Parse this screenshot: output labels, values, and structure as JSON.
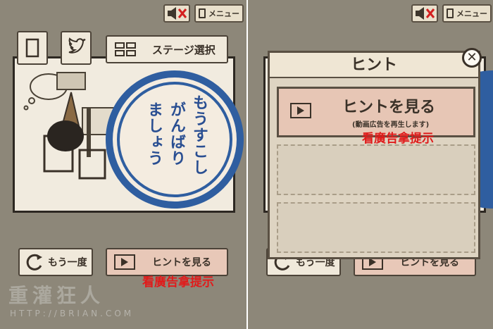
{
  "left": {
    "topbar": {
      "menu_label": "メニュー"
    },
    "stage_select_label": "ステージ選択",
    "encouragement": [
      "もうすこし",
      "がんばり",
      "ましょう"
    ],
    "retry_label": "もう一度",
    "hint_label": "ヒントを見る",
    "caption": "看廣告拿提示",
    "watermark": "重灌狂人",
    "watermark_url": "HTTP://BRIAN.COM"
  },
  "right": {
    "topbar": {
      "menu_label": "メニュー"
    },
    "modal": {
      "title": "ヒント",
      "close_glyph": "✕",
      "hint_title": "ヒントを見る",
      "hint_sub": "(動画広告を再生します)"
    },
    "caption": "看廣告拿提示",
    "retry_label": "もう一度",
    "hint_label": "ヒントを見る"
  },
  "icons": [
    "sound-mute-icon",
    "menu-doc-icon",
    "tablet-icon",
    "twitter-icon",
    "grid-icon",
    "replay-icon",
    "play-icon",
    "close-icon"
  ],
  "colors": {
    "accent_blue": "#2f5ea0",
    "caption_red": "#e01b1b",
    "panel_bg": "#8d8779"
  }
}
